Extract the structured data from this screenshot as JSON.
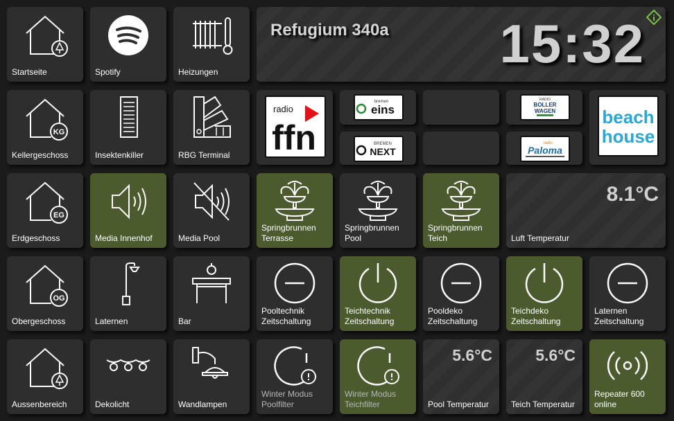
{
  "header": {
    "title": "Refugium 340a",
    "clock": "15:32"
  },
  "tiles": {
    "startseite": "Startseite",
    "spotify": "Spotify",
    "heizungen": "Heizungen",
    "kellergeschoss": "Kellergeschoss",
    "insektenkiller": "Insektenkiller",
    "rbg_terminal": "RBG Terminal",
    "erdgeschoss": "Erdgeschoss",
    "media_innenhof": "Media Innenhof",
    "media_pool": "Media Pool",
    "springbrunnen_terrasse": [
      "Springbrunnen",
      "Terrasse"
    ],
    "springbrunnen_pool": [
      "Springbrunnen",
      "Pool"
    ],
    "springbrunnen_teich": [
      "Springbrunnen",
      "Teich"
    ],
    "luft_temperatur": {
      "label": "Luft Temperatur",
      "value": "8.1°C"
    },
    "obergeschoss": "Obergeschoss",
    "laternen": "Laternen",
    "bar": "Bar",
    "pooltechnik": [
      "Pooltechnik",
      "Zeitschaltung"
    ],
    "teichtechnik": [
      "Teichtechnik",
      "Zeitschaltung"
    ],
    "pooldeko": [
      "Pooldeko",
      "Zeitschaltung"
    ],
    "teichdeko": [
      "Teichdeko",
      "Zeitschaltung"
    ],
    "laternen_zeit": [
      "Laternen",
      "Zeitschaltung"
    ],
    "aussenbereich": "Aussenbereich",
    "dekolicht": "Dekolicht",
    "wandlampen": "Wandlampen",
    "winter_poolfilter": [
      "Winter Modus",
      "Poolfilter"
    ],
    "winter_teichfilter": [
      "Winter Modus",
      "Teichfilter"
    ],
    "pool_temperatur": {
      "label": "Pool Temperatur",
      "value": "5.6°C"
    },
    "teich_temperatur": {
      "label": "Teich Temperatur",
      "value": "5.6°C"
    },
    "repeater": [
      "Repeater 600",
      "online"
    ]
  },
  "house_badges": {
    "kg": "KG",
    "eg": "EG",
    "og": "OG"
  },
  "radio_logos": {
    "ffn_top": "radio",
    "ffn_main": "ffn",
    "bremen_eins_top": "bremen",
    "bremen_eins_main": "eins",
    "bremen_next_top": "BREMEN",
    "bremen_next_main": "NEXT",
    "boller_top": "RADIO",
    "boller_1": "BOLLER",
    "boller_2": "WAGEN",
    "paloma_top": "radio",
    "paloma_main": "Paloma",
    "beach_1": "beach",
    "beach_2": "house"
  },
  "colors": {
    "active_tile": "#4c5b2d",
    "tile": "#2e2e2e",
    "background": "#1b1b1b",
    "info_badge": "#7fc241"
  }
}
